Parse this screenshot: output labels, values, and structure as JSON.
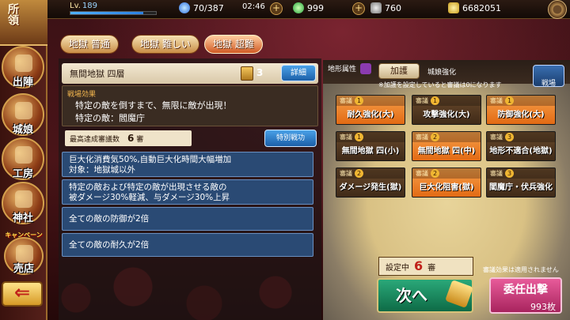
{
  "top": {
    "level_label": "Lv.",
    "level": "189",
    "exp_fill": 0.85,
    "stamina": "70/387",
    "timer": "02:46",
    "green_gems": "999",
    "pots": "760",
    "gold": "6682051"
  },
  "sidebar": {
    "title": "所領",
    "items": [
      "出陣",
      "城娘",
      "工房",
      "神社",
      "売店"
    ],
    "campaign": "キャンペーン"
  },
  "tabs": [
    "地獄 普通",
    "地獄 難しい",
    "地獄 超難"
  ],
  "stage": {
    "title": "無間地獄 四層",
    "scroll_count": "3",
    "detail": "詳細"
  },
  "effect": {
    "label": "戦場効果",
    "line1": "特定の敵を倒すまで、無限に敵が出現！",
    "line2": "特定の敵：閻魔庁"
  },
  "max": {
    "label": "最高達成審議数",
    "value": "6",
    "unit": "審"
  },
  "special_btn": "特別戦功",
  "effect_items": [
    {
      "l1": "巨大化消費気50%,自動巨大化時間大幅増加",
      "l2": "対象：地獄城以外"
    },
    {
      "l1": "特定の敵および特定の敵が出現させる敵の",
      "l2": "被ダメージ30%軽減、与ダメージ30%上昇"
    },
    {
      "l1": "全ての敵の防御が2倍",
      "l2": ""
    },
    {
      "l1": "全ての敵の耐久が2倍",
      "l2": ""
    }
  ],
  "board": {
    "terrain": "地形属性",
    "kago": "加護",
    "kago_desc": "城娘強化",
    "note": "※加護を設定していると審議は0になります",
    "battle": "戦場"
  },
  "cards": [
    {
      "head": "審議",
      "num": "1",
      "name": "耐久強化(大)",
      "color": "orange"
    },
    {
      "head": "審議",
      "num": "1",
      "name": "攻撃強化(大)",
      "color": "brown"
    },
    {
      "head": "審議",
      "num": "1",
      "name": "防御強化(大)",
      "color": "orange"
    },
    {
      "head": "審議",
      "num": "1",
      "name": "無間地獄 四(小)",
      "color": "brown"
    },
    {
      "head": "審議",
      "num": "2",
      "name": "無間地獄 四(中)",
      "color": "orange"
    },
    {
      "head": "審議",
      "num": "3",
      "name": "地形不適合(地獄)",
      "color": "brown"
    },
    {
      "head": "審議",
      "num": "2",
      "name": "ダメージ発生(獄)",
      "color": "brown"
    },
    {
      "head": "審議",
      "num": "2",
      "name": "巨大化阻害(獄)",
      "color": "orange"
    },
    {
      "head": "審議",
      "num": "3",
      "name": "閻魔庁・伏兵強化",
      "color": "brown"
    }
  ],
  "setting": {
    "label": "設定中",
    "value": "6",
    "unit": "審"
  },
  "next": "次へ",
  "noapply": "審議効果は適用されません",
  "entrust": {
    "label": "委任出撃",
    "count": "993枚"
  }
}
